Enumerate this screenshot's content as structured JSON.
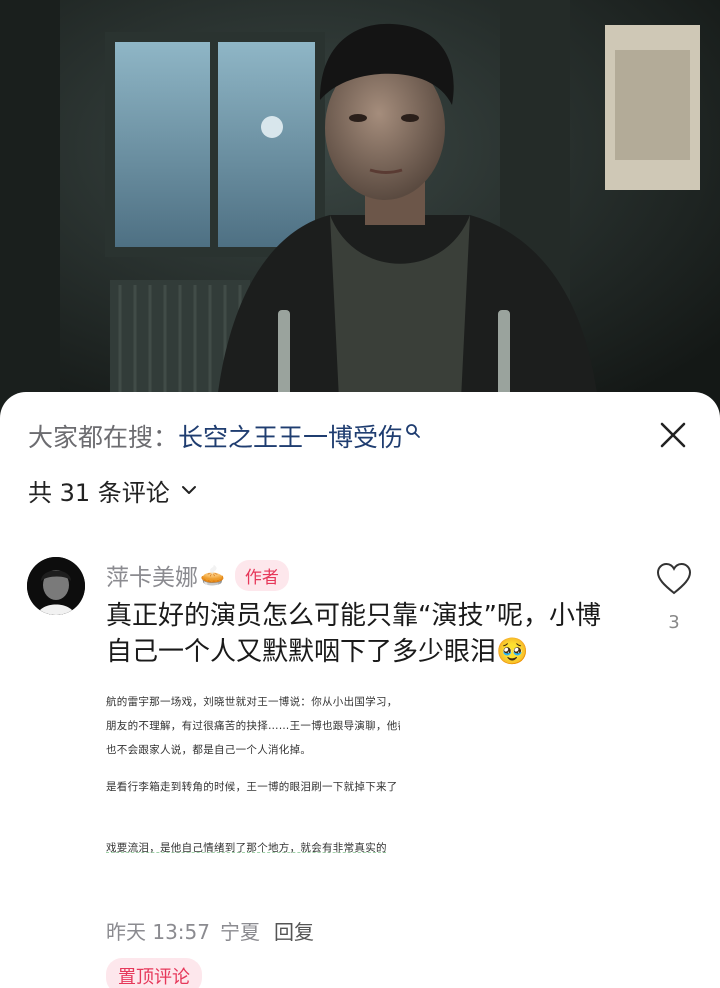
{
  "search_bar": {
    "label": "大家都在搜：",
    "term": "长空之王王一博受伤"
  },
  "comments": {
    "count_text": "共 31 条评论"
  },
  "comment": {
    "username": "萍卡美娜",
    "username_emoji": "🥧",
    "author_badge": "作者",
    "text": "真正好的演员怎么可能只靠“演技”呢，小博自己一个人又默默咽下了多少眼泪🥹",
    "likes": "3",
    "date": "昨天 13:57",
    "location": "宁夏",
    "reply_label": "回复",
    "pinned_label": "置顶评论",
    "attached_image_lines": [
      "航的雷宇那一场戏，刘晓世就对王一博说：你从小出国学习，",
      "朋友的不理解，有过很痛苦的抉择……王一博也跟导演聊，他都",
      "也不会跟家人说，都是自己一个人消化掉。",
      "是看行李箱走到转角的时候，王一博的眼泪刷一下就掉下来了",
      "戏要流泪，是他自己情绪到了那个地方，就会有非常真实的"
    ]
  },
  "icons": {
    "search_suggest": "search-icon",
    "close": "close-icon",
    "expand": "chevron-down-icon",
    "like": "heart-outline-icon"
  },
  "colors": {
    "badge_bg": "#fde7ec",
    "badge_text": "#e6385a",
    "search_term": "#1f3d70"
  }
}
